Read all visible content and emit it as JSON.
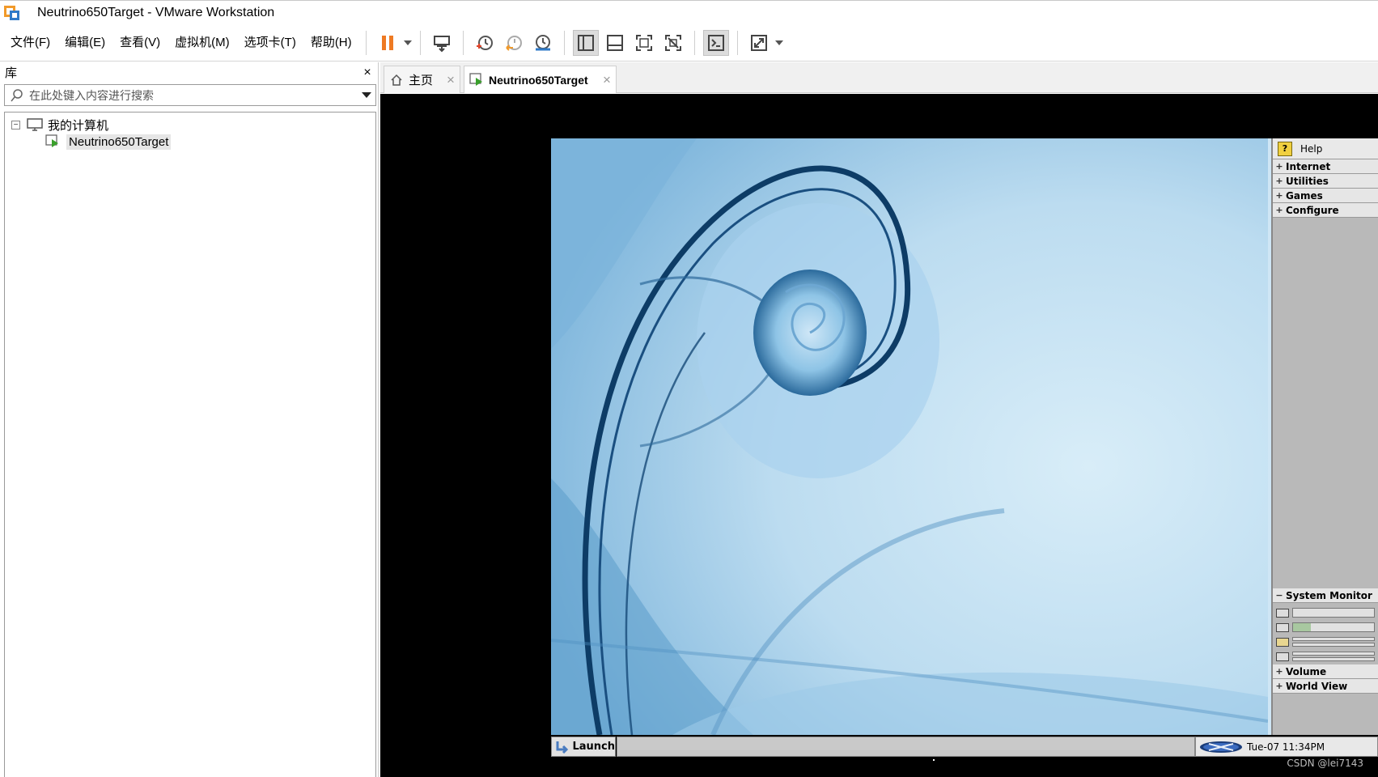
{
  "window": {
    "title": "Neutrino650Target - VMware Workstation"
  },
  "menu": {
    "items": [
      "文件(F)",
      "编辑(E)",
      "查看(V)",
      "虚拟机(M)",
      "选项卡(T)",
      "帮助(H)"
    ]
  },
  "toolbar": {
    "icons": [
      "pause-icon",
      "send-ctrl-alt-del-icon",
      "snapshot-take-icon",
      "snapshot-revert-icon",
      "snapshot-manager-icon",
      "show-library-icon",
      "show-thumbnail-icon",
      "fullscreen-icon",
      "unity-icon",
      "console-view-icon",
      "stretch-guest-icon"
    ],
    "colors": {
      "pause": "#ee7a23",
      "accent_blue": "#2f7ac8",
      "accent_orange": "#f19a2a"
    }
  },
  "library": {
    "title": "库",
    "close_glyph": "×",
    "search_placeholder": "在此处键入内容进行搜索",
    "tree": {
      "root_label": "我的计算机",
      "root_expander": "−",
      "children": [
        {
          "label": "Neutrino650Target"
        }
      ]
    }
  },
  "tabs": [
    {
      "label": "主页",
      "icon": "home-icon",
      "close_glyph": "×"
    },
    {
      "label": "Neutrino650Target",
      "icon": "vm-running-icon",
      "close_glyph": "×"
    }
  ],
  "guest": {
    "side_panel": {
      "help": "Help",
      "help_glyph": "?",
      "groups": [
        "Internet",
        "Utilities",
        "Games",
        "Configure"
      ],
      "plus_glyph": "+",
      "minus_glyph": "−",
      "system_monitor": "System Monitor",
      "monitor_levels": {
        "cpu": 0.0,
        "memory": 0.22
      },
      "bottom_groups": [
        "Volume",
        "World View"
      ]
    },
    "shelf": {
      "launch": "Launch",
      "clock": "Tue-07 11:34PM"
    },
    "watermark": "CSDN @lei7143",
    "wallpaper_colors": {
      "light": "#d4eaf6",
      "mid": "#8fc3e6",
      "dark": "#0d3c66"
    }
  }
}
